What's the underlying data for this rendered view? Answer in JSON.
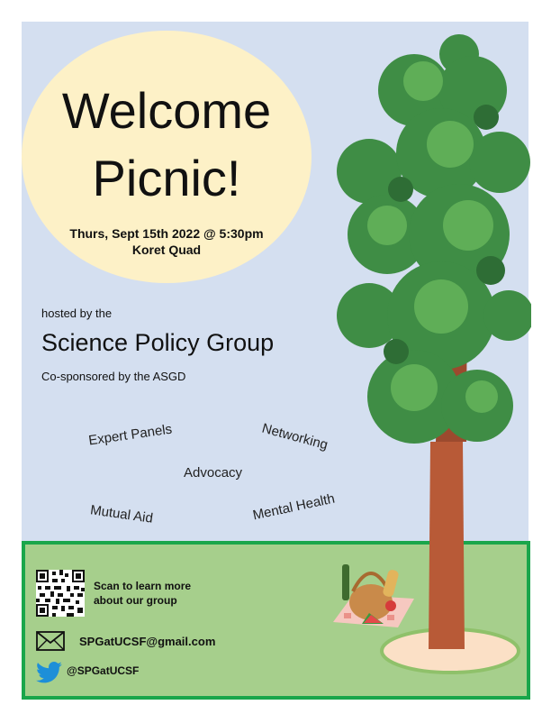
{
  "colors": {
    "sky": "#d4dff0",
    "grass": "#a6cf8c",
    "grass_border": "#1aa64b",
    "sun": "#fdf1c7",
    "trunk": "#b85a37",
    "foliage": "#3f8d45"
  },
  "headline": {
    "line1": "Welcome",
    "line2": "Picnic!"
  },
  "event": {
    "date_time": "Thurs, Sept 15th 2022 @ 5:30pm",
    "location": "Koret Quad"
  },
  "host": {
    "intro": "hosted by the",
    "name": "Science Policy Group",
    "cosponsor": "Co-sponsored by the ASGD"
  },
  "topics": [
    "Expert Panels",
    "Networking",
    "Advocacy",
    "Mutual Aid",
    "Mental Health"
  ],
  "contact": {
    "scan_line1": "Scan to learn more",
    "scan_line2": "about our group",
    "email": "SPGatUCSF@gmail.com",
    "twitter": "@SPGatUCSF"
  },
  "icons": {
    "qr": "qr-code-icon",
    "mail": "envelope-icon",
    "twitter": "twitter-bird-icon"
  }
}
